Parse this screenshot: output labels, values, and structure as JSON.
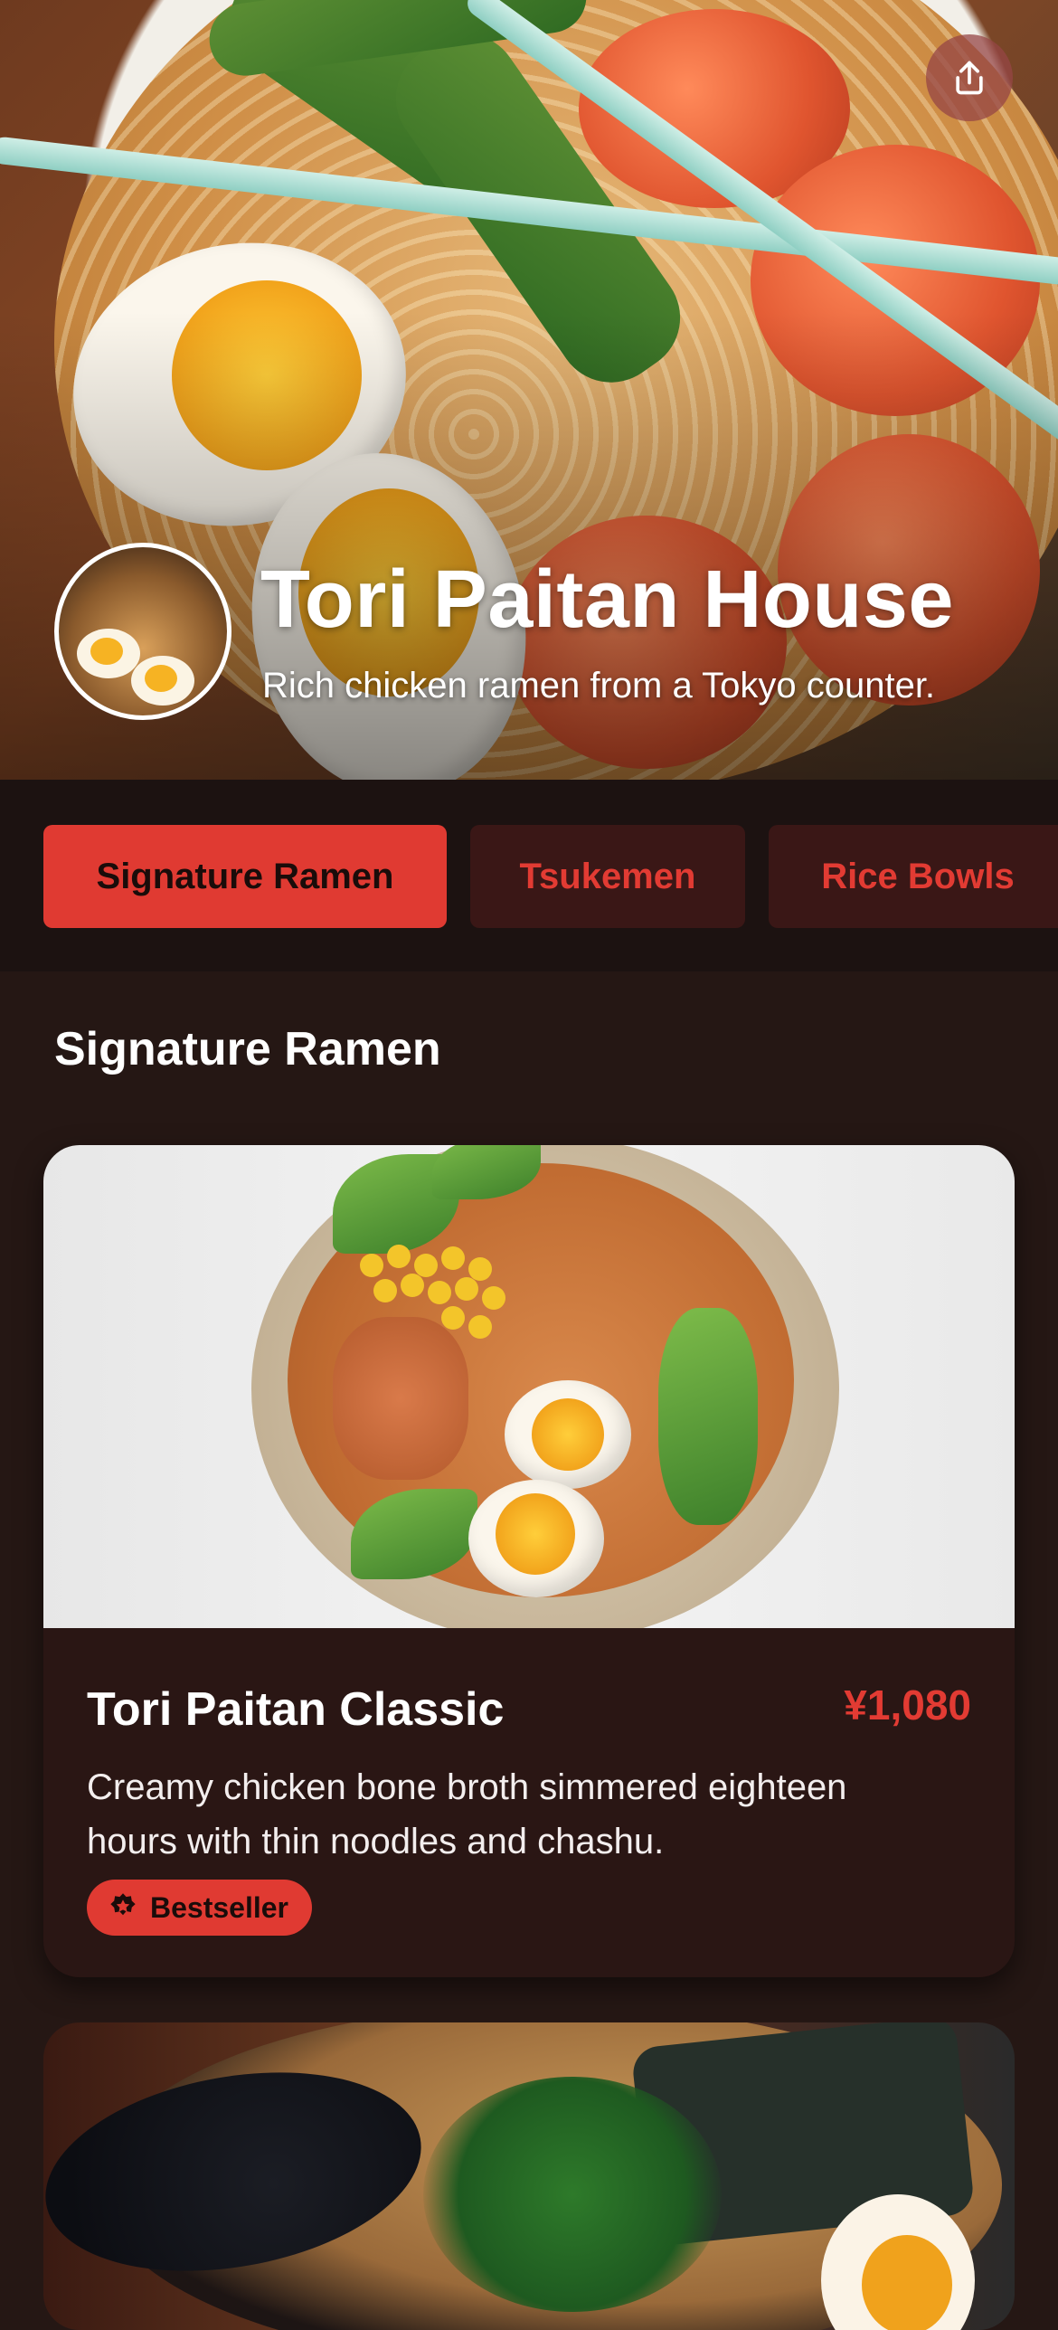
{
  "header": {
    "restaurant_name": "Tori Paitan House",
    "tagline": "Rich chicken ramen from a Tokyo counter.",
    "share_icon": "share-icon"
  },
  "tabs": [
    {
      "label": "Signature Ramen",
      "active": true
    },
    {
      "label": "Tsukemen",
      "active": false
    },
    {
      "label": "Rice Bowls",
      "active": false
    }
  ],
  "section": {
    "title": "Signature Ramen"
  },
  "items": [
    {
      "name": "Tori Paitan Classic",
      "price": "¥1,080",
      "description": "Creamy chicken bone broth simmered eighteen hours with thin noodles and chashu.",
      "badge": "Bestseller",
      "badge_icon": "badge-star-icon"
    }
  ],
  "colors": {
    "accent": "#e03a32",
    "background": "#251714",
    "tab_inactive_bg": "#3a1716",
    "price": "#e23b33"
  }
}
